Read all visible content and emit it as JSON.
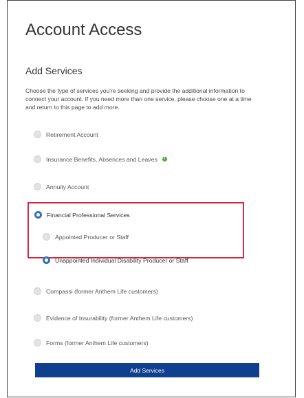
{
  "page": {
    "title": "Account Access",
    "section_title": "Add Services",
    "description": "Choose the type of services you're seeking and provide the additional information to connect your account. If you need more than one service, please choose one at a time and return to this page to add more."
  },
  "options": [
    {
      "label": "Retirement Account",
      "selected": false
    },
    {
      "label": "Insurance Benefits, Absences and Leaves",
      "selected": false,
      "info_icon": "info-icon"
    },
    {
      "label": "Annuity Account",
      "selected": false
    },
    {
      "label": "Financial Professional Services",
      "selected": true
    },
    {
      "label": "Appointed Producer or Staff",
      "selected": false
    },
    {
      "label": "Unappointed Individual Disability Producer or Staff",
      "selected": true
    },
    {
      "label": "Compassi (former Anthem Life customers)",
      "selected": false
    },
    {
      "label": "Evidence of Insurability (former Anthem Life customers)",
      "selected": false
    },
    {
      "label": "Forms (former Anthem Life customers)",
      "selected": false
    }
  ],
  "button": {
    "label": "Add Services"
  },
  "colors": {
    "accent": "#2f73b8",
    "button_bg": "#0f3f8f",
    "highlight_border": "#d7263d",
    "info_badge": "#4fa83d"
  }
}
